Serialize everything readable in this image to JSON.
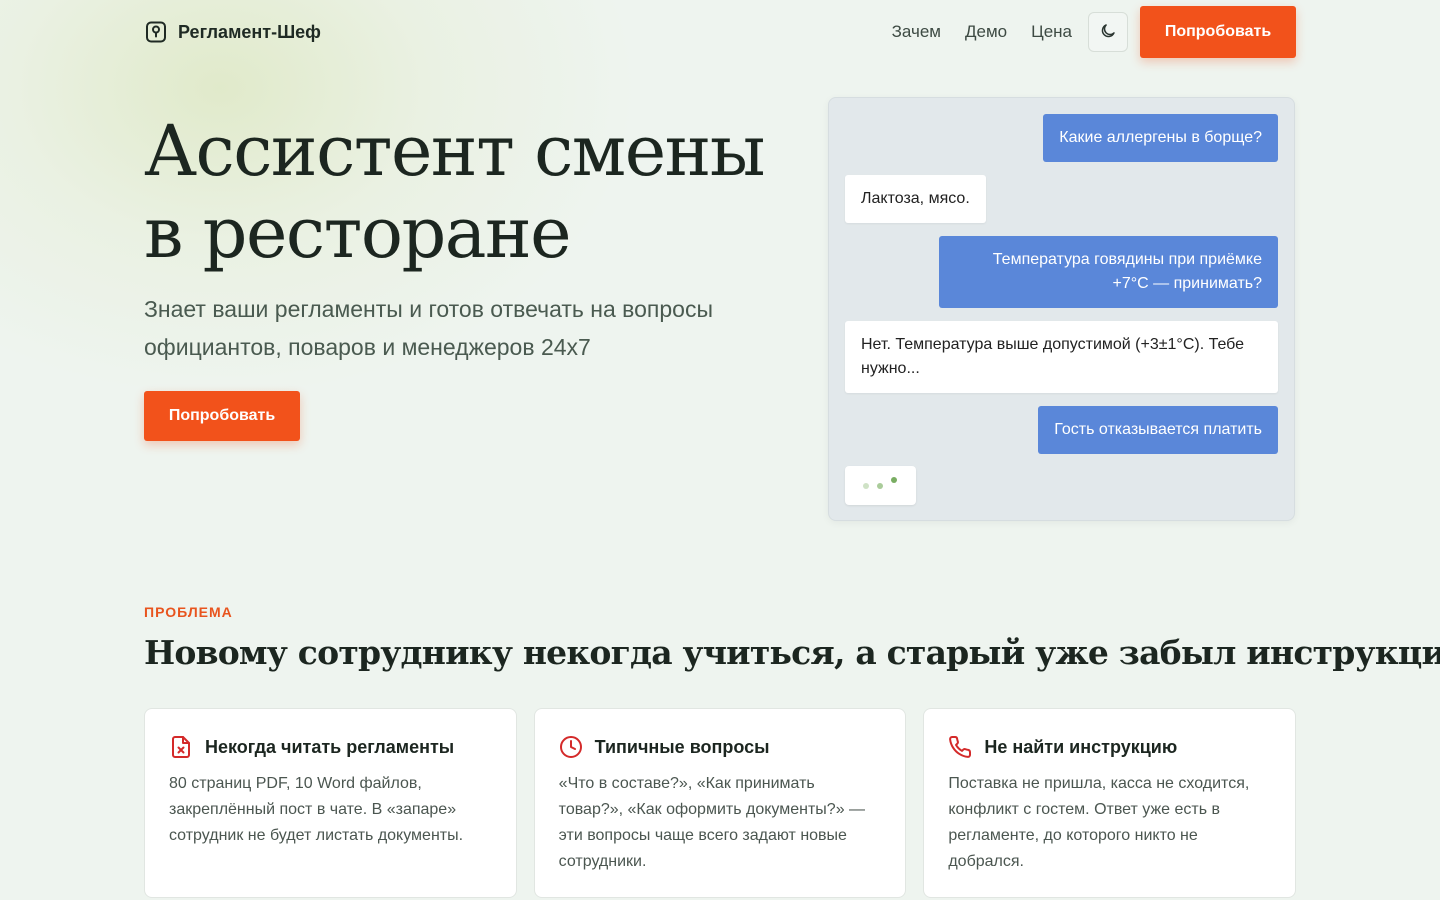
{
  "brand": {
    "name": "Регламент-Шеф",
    "icon": "location-pin-icon"
  },
  "nav": {
    "links": [
      "Зачем",
      "Демо",
      "Цена"
    ],
    "theme_icon": "moon-icon",
    "cta_label": "Попробовать"
  },
  "hero": {
    "title": "Ассистент смены в ресторане",
    "subtitle": "Знает ваши регламенты и готов отвечать на вопросы официантов, поваров и менеджеров 24х7",
    "cta_label": "Попробовать"
  },
  "chat": {
    "messages": [
      {
        "role": "user",
        "text": "Какие аллергены в борще?"
      },
      {
        "role": "bot",
        "text": "Лактоза, мясо."
      },
      {
        "role": "user",
        "text": "Температура говядины при приёмке +7°C — принимать?"
      },
      {
        "role": "bot",
        "text": "Нет. Температура выше допустимой (+3±1°C). Тебе нужно..."
      },
      {
        "role": "user",
        "text": "Гость отказывается платить"
      }
    ],
    "typing_indicator": "typing-dots-icon"
  },
  "problem": {
    "label": "ПРОБЛЕМА",
    "title": "Новому сотруднику некогда учиться, а старый уже забыл инструкции",
    "cards": [
      {
        "icon": "file-x-icon",
        "title": "Некогда читать регламенты",
        "text": "80 страниц PDF, 10 Word файлов, закреплённый пост в чате. В «запаре» сотрудник не будет листать документы."
      },
      {
        "icon": "clock-icon",
        "title": "Типичные вопросы",
        "text": "«Что в составе?», «Как принимать товар?», «Как оформить документы?» — эти вопросы чаще всего задают новые сотрудники."
      },
      {
        "icon": "phone-icon",
        "title": "Не найти инструкцию",
        "text": "Поставка не пришла, касса не сходится, конфликт с гостем. Ответ уже есть в регламенте, до которого никто не добрался."
      }
    ]
  },
  "colors": {
    "accent": "#f2521b",
    "user_bubble": "#5a87d9",
    "icon_red": "#d42a2a",
    "background": "#eef4ef"
  }
}
